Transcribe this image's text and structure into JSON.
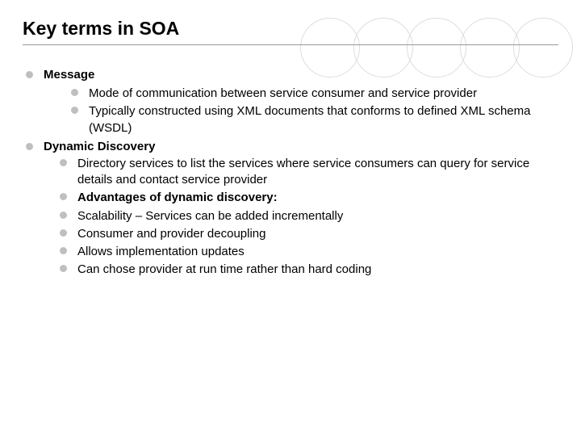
{
  "title": "Key terms in SOA",
  "sections": [
    {
      "heading": "Message",
      "items": [
        {
          "text": "Mode of communication between service consumer and service provider",
          "bold": false
        },
        {
          "text": "Typically constructed using XML documents that conforms to defined XML schema (WSDL)",
          "bold": false
        }
      ]
    },
    {
      "heading": "Dynamic Discovery",
      "items": [
        {
          "text": "Directory services to list the services where service consumers can query for service details and contact service provider",
          "bold": false
        },
        {
          "text": "Advantages of dynamic discovery:",
          "bold": true
        },
        {
          "text": "Scalability – Services can be added incrementally",
          "bold": false
        },
        {
          "text": "Consumer and provider decoupling",
          "bold": false
        },
        {
          "text": "Allows implementation updates",
          "bold": false
        },
        {
          "text": "Can chose provider at run time rather than hard coding",
          "bold": false
        }
      ]
    }
  ]
}
